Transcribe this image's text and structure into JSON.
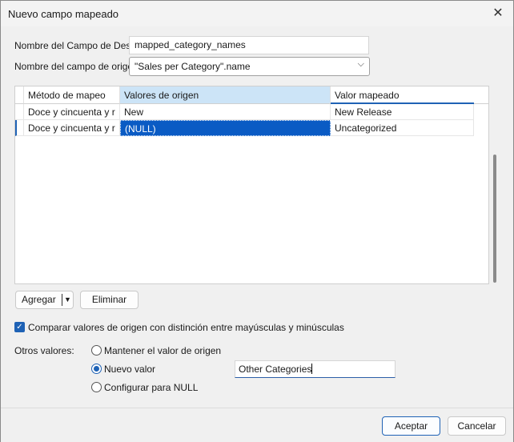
{
  "window": {
    "title": "Nuevo campo mapeado"
  },
  "fields": {
    "dest_label": "Nombre del Campo de Destino:",
    "dest_value": "mapped_category_names",
    "source_label": "Nombre del campo de origen:",
    "source_value": "\"Sales per Category\".name"
  },
  "grid": {
    "columns": [
      "Método de mapeo",
      "Valores de origen",
      "Valor mapeado"
    ],
    "rows": [
      [
        "Doce y cincuenta y r",
        "New",
        "New Release"
      ],
      [
        "Doce y cincuenta y r",
        "(NULL)",
        "Uncategorized"
      ]
    ]
  },
  "buttons": {
    "add": "Agregar",
    "remove": "Eliminar",
    "ok": "Aceptar",
    "cancel": "Cancelar"
  },
  "case_sensitive": {
    "label": "Comparar valores de origen con distinción entre mayúsculas y minúsculas",
    "checked": true
  },
  "other_values": {
    "label": "Otros valores:",
    "options": [
      "Mantener el valor de origen",
      "Nuevo valor",
      "Configurar para NULL"
    ],
    "selected": "Nuevo valor",
    "new_value": "Other Categories"
  },
  "icons": {
    "close": "close-icon",
    "dropdown": "chevron-down-icon",
    "split": "caret-down-icon",
    "check": "check-icon"
  },
  "colors": {
    "accent": "#1f62b5",
    "header_selected": "#cce4f7",
    "selection": "#0a5bc4"
  }
}
